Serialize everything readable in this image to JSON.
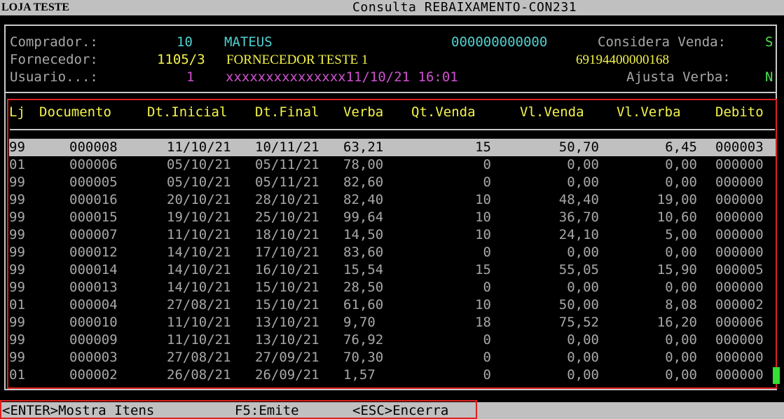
{
  "titlebar": {
    "store": "LOJA TESTE",
    "title": "Consulta REBAIXAMENTO-CON231"
  },
  "header": {
    "comprador_label": "Comprador.:",
    "comprador_code": "10",
    "comprador_name": "MATEUS",
    "comprador_doc": "000000000000",
    "considera_label": "Considera Venda:",
    "considera_value": "S",
    "fornecedor_label": "Fornecedor:",
    "fornecedor_code": "1105/3",
    "fornecedor_name": "FORNECEDOR TESTE 1",
    "fornecedor_cnpj": "69194400000168",
    "usuario_label": "Usuario...:",
    "usuario_code": "1",
    "usuario_name": "xxxxxxxxxxxxxxx11/10/21 16:01",
    "ajusta_label": "Ajusta Verba:",
    "ajusta_value": "N"
  },
  "table": {
    "columns": [
      "Lj",
      "Documento",
      "Dt.Inicial",
      "Dt.Final",
      "Verba",
      "Qt.Venda",
      "Vl.Venda",
      "Vl.Verba",
      "Debito"
    ],
    "rows": [
      [
        "99",
        "000008",
        "11/10/21",
        "10/11/21",
        "63,21",
        "15",
        "50,70",
        "6,45",
        "000003"
      ],
      [
        "01",
        "000006",
        "05/10/21",
        "05/11/21",
        "78,00",
        "0",
        "0,00",
        "0,00",
        "000000"
      ],
      [
        "99",
        "000005",
        "05/10/21",
        "05/11/21",
        "82,60",
        "0",
        "0,00",
        "0,00",
        "000000"
      ],
      [
        "99",
        "000016",
        "20/10/21",
        "28/10/21",
        "82,40",
        "10",
        "48,40",
        "19,00",
        "000000"
      ],
      [
        "99",
        "000015",
        "19/10/21",
        "25/10/21",
        "99,64",
        "10",
        "36,70",
        "10,60",
        "000000"
      ],
      [
        "99",
        "000007",
        "11/10/21",
        "18/10/21",
        "14,50",
        "10",
        "24,10",
        "5,00",
        "000000"
      ],
      [
        "99",
        "000012",
        "14/10/21",
        "17/10/21",
        "83,60",
        "0",
        "0,00",
        "0,00",
        "000000"
      ],
      [
        "99",
        "000014",
        "14/10/21",
        "16/10/21",
        "15,54",
        "15",
        "55,05",
        "15,90",
        "000005"
      ],
      [
        "99",
        "000013",
        "14/10/21",
        "15/10/21",
        "28,50",
        "0",
        "0,00",
        "0,00",
        "000000"
      ],
      [
        "01",
        "000004",
        "27/08/21",
        "15/10/21",
        "61,60",
        "10",
        "50,00",
        "8,08",
        "000002"
      ],
      [
        "99",
        "000010",
        "11/10/21",
        "13/10/21",
        "9,70",
        "18",
        "75,52",
        "16,20",
        "000006"
      ],
      [
        "99",
        "000009",
        "11/10/21",
        "13/10/21",
        "76,92",
        "0",
        "0,00",
        "0,00",
        "000000"
      ],
      [
        "99",
        "000003",
        "27/08/21",
        "27/09/21",
        "70,30",
        "0",
        "0,00",
        "0,00",
        "000000"
      ],
      [
        "01",
        "000002",
        "26/08/21",
        "26/09/21",
        "1,57",
        "0",
        "0,00",
        "0,00",
        "000000"
      ]
    ]
  },
  "statusbar": {
    "enter": "<ENTER>Mostra Itens",
    "f5": "F5:Emite",
    "esc": "<ESC>Encerra"
  },
  "colors": {
    "background": "#000000",
    "text": "#a8a8a8",
    "header_text": "#f4f44a",
    "highlight": "#e02020",
    "selection": "#c0c0c0"
  }
}
